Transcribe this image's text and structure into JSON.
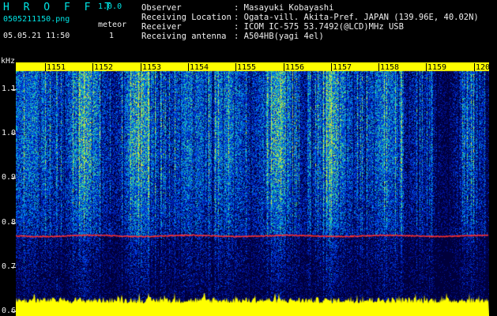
{
  "app": {
    "title": "H R O F F T",
    "version": "1.0.0"
  },
  "capture": {
    "filename": "0505211150.png",
    "datetime": "05.05.21 11:50",
    "meteor_label": "meteor",
    "meteor_count": "1"
  },
  "station": {
    "observer_label": "Observer",
    "observer_value": ": Masayuki Kobayashi",
    "location_label": "Receiving Location",
    "location_value": ": Ogata-vill. Akita-Pref. JAPAN (139.96E, 40.02N)",
    "receiver_label": "Receiver",
    "receiver_value": ": ICOM IC-575 53.7492(@LCD)MHz USB",
    "antenna_label": "Receiving antenna",
    "antenna_value": ": A504HB(yagi 4el)"
  },
  "spectrogram": {
    "y_unit": "kHz",
    "y_ticks": [
      "1.1",
      "1.0",
      "0.9",
      "0.8",
      "0.7",
      "0.6"
    ],
    "y_tick_values": [
      1.1,
      1.0,
      0.9,
      0.8,
      0.7,
      0.6
    ],
    "x_ticks": [
      "1151",
      "1152",
      "1153",
      "1154",
      "1155",
      "1156",
      "1157",
      "1158",
      "1159",
      "1200"
    ],
    "y_range": [
      0.59,
      1.16
    ],
    "carrier_khz": 0.77,
    "colors": {
      "header_cyan": "#00e6e6",
      "tick_bar": "#ffff00",
      "carrier_line": "#ff3030",
      "noise_floor": "#ffff00"
    }
  }
}
